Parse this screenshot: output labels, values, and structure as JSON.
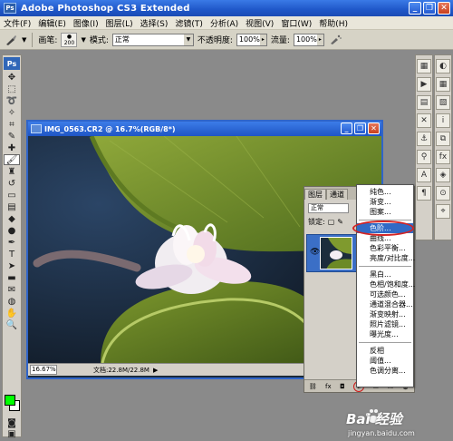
{
  "app": {
    "title": "Adobe Photoshop CS3 Extended",
    "logo": "Ps"
  },
  "window_controls": {
    "minimize": "_",
    "restore": "❐",
    "close": "✕"
  },
  "menu": [
    "文件(F)",
    "编辑(E)",
    "图像(I)",
    "图层(L)",
    "选择(S)",
    "滤镜(T)",
    "分析(A)",
    "视图(V)",
    "窗口(W)",
    "帮助(H)"
  ],
  "options_bar": {
    "brush_label": "画笔:",
    "brush_size": "200",
    "mode_label": "模式:",
    "mode_value": "正常",
    "opacity_label": "不透明度:",
    "opacity_value": "100%",
    "flow_label": "流量:",
    "flow_value": "100%"
  },
  "document": {
    "title": "IMG_0563.CR2 @ 16.7%(RGB/8*)",
    "zoom": "16.67%",
    "info": "文档:22.8M/22.8M"
  },
  "layers_panel": {
    "tabs": [
      "图层",
      "通道"
    ],
    "blend_mode": "正常",
    "lock_label": "锁定:"
  },
  "adjustment_menu": {
    "groups": [
      [
        "纯色...",
        "渐变...",
        "图案..."
      ],
      [
        "色阶...",
        "曲线...",
        "色彩平衡...",
        "亮度/对比度..."
      ],
      [
        "黑白...",
        "色相/饱和度...",
        "可选颜色...",
        "通道混合器...",
        "渐变映射...",
        "照片滤镜...",
        "曝光度..."
      ],
      [
        "反相",
        "阈值...",
        "色调分离..."
      ]
    ],
    "highlighted": "色阶..."
  },
  "watermark": {
    "brand": "Bai 经验",
    "url": "jingyan.baidu.com"
  },
  "colors": {
    "foreground": "#00ff00",
    "background": "#ffffff",
    "title_blue": "#1f57c8",
    "highlight_red": "#d42424"
  }
}
